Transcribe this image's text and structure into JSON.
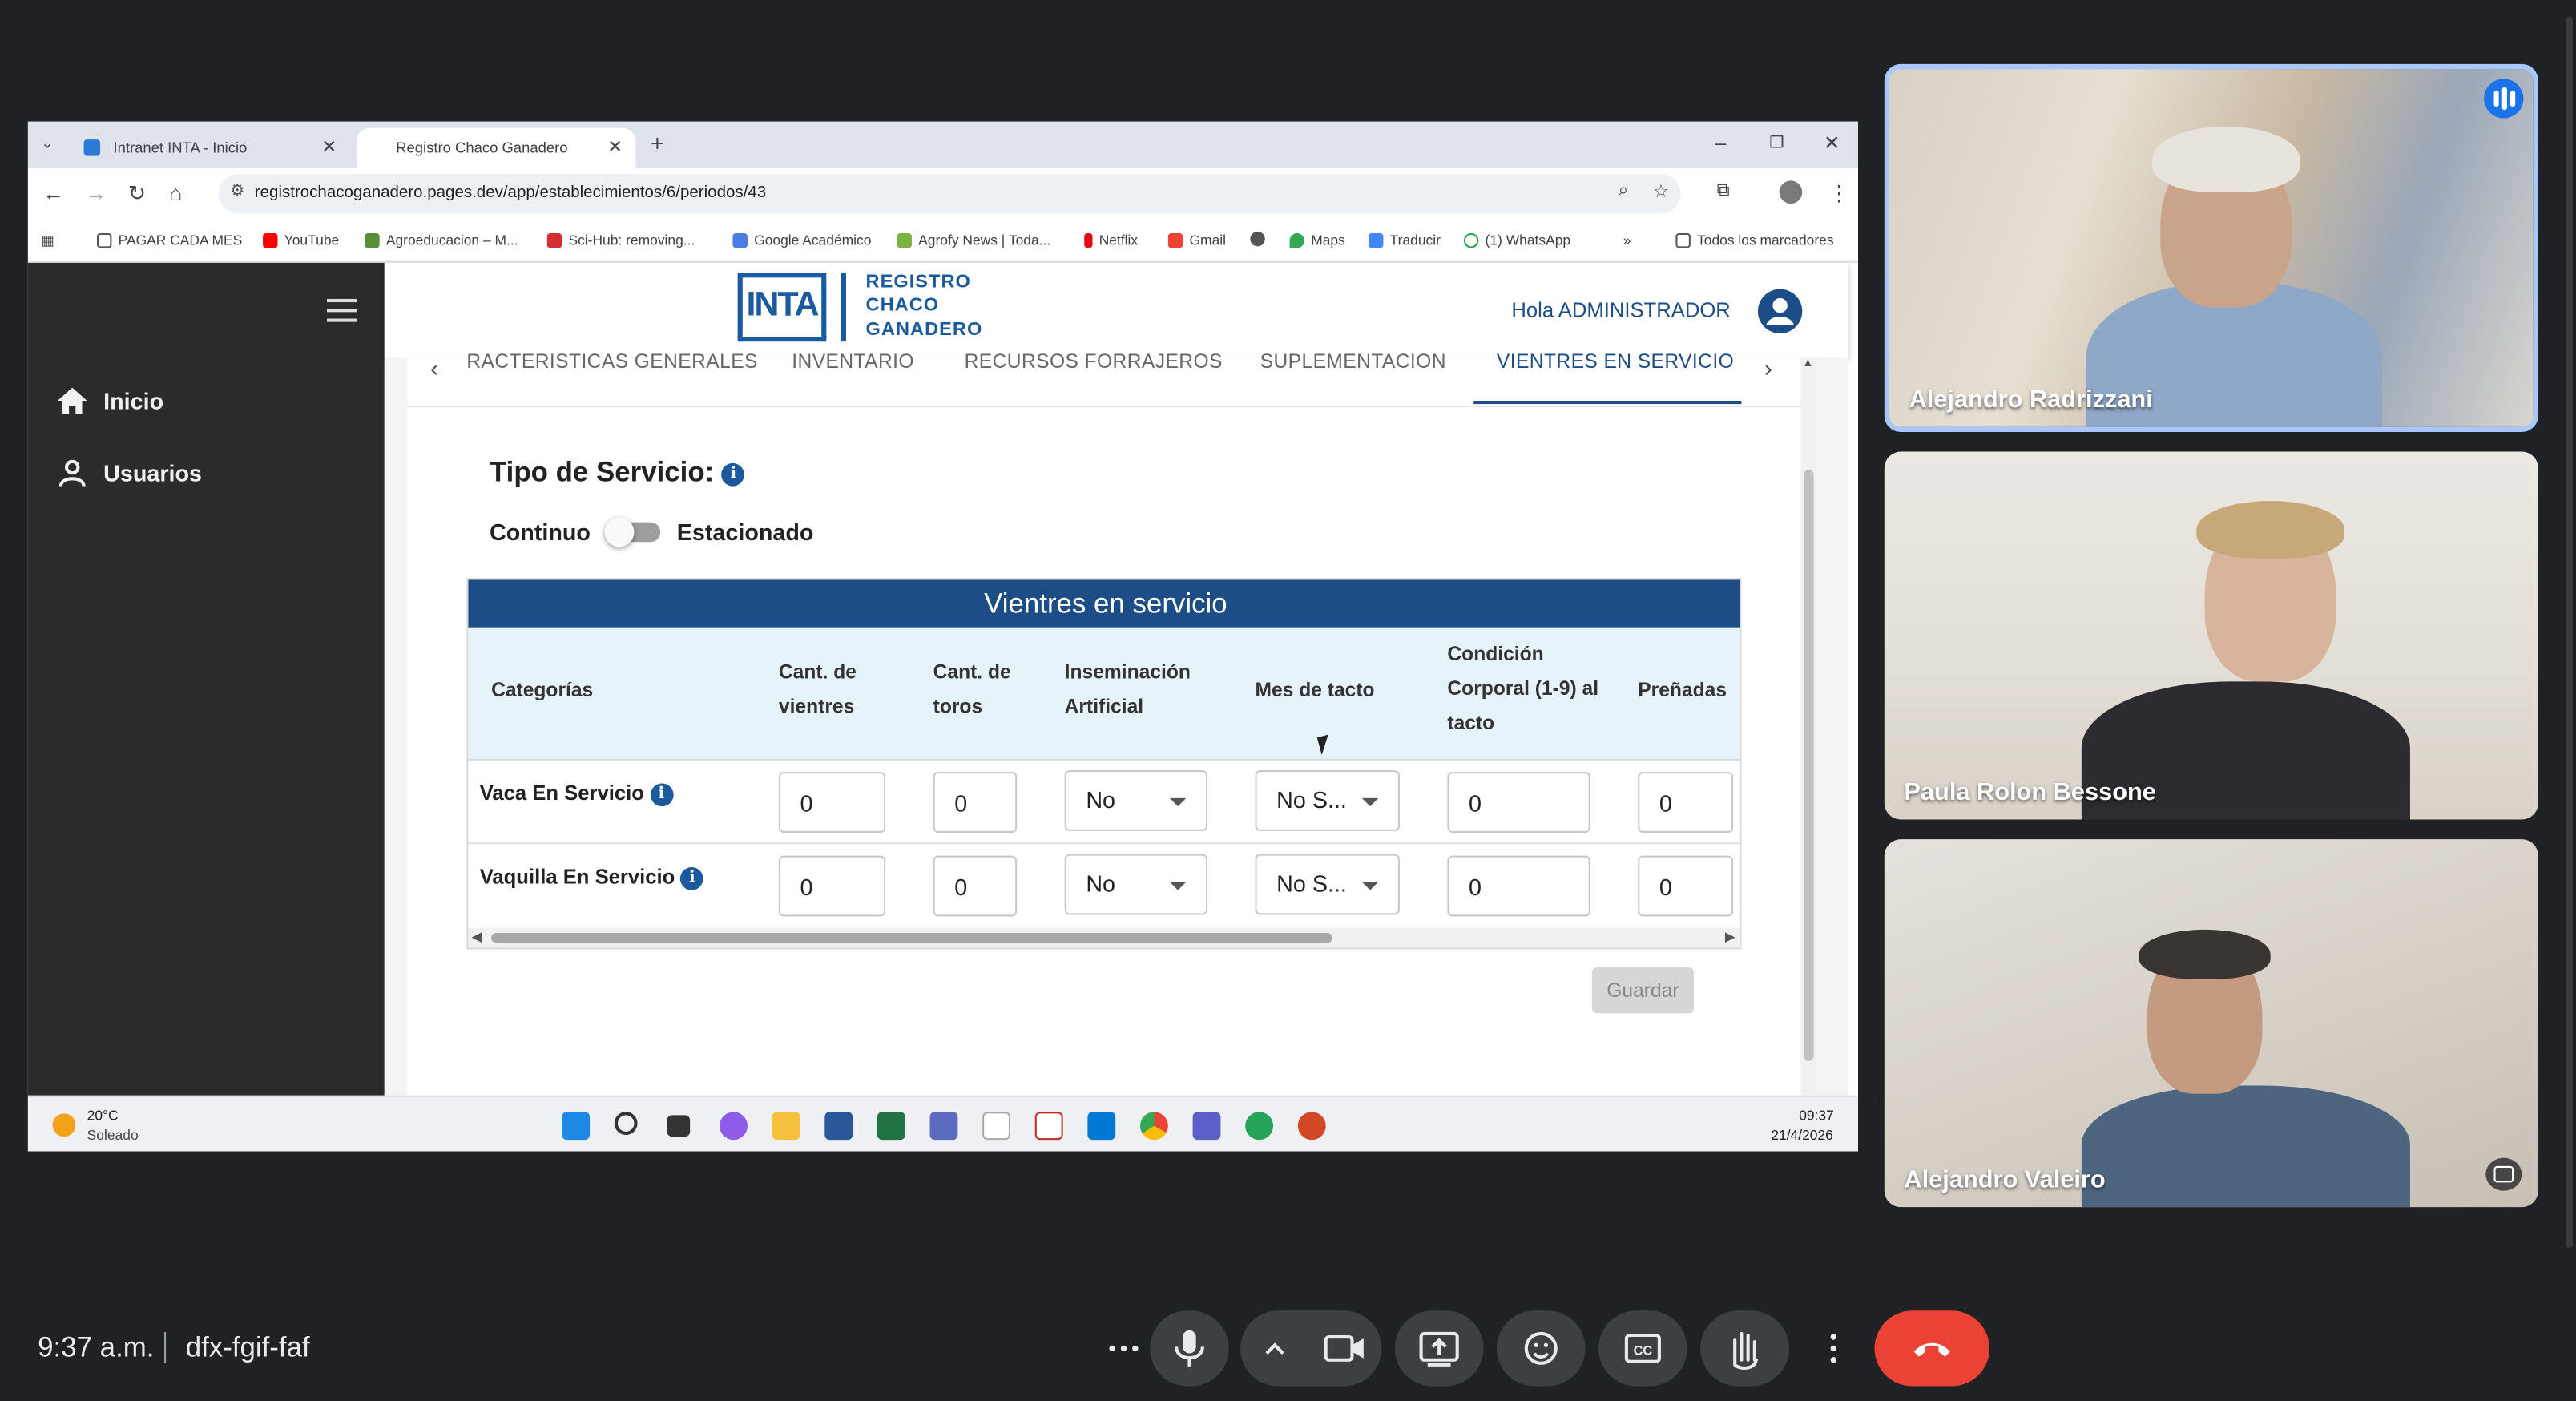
{
  "meet": {
    "time": "9:37 a.m.",
    "meeting_code": "dfx-fgif-faf"
  },
  "participants": [
    {
      "name": "Alejandro Radrizzani",
      "speaking": true
    },
    {
      "name": "Paula Rolon Bessone",
      "speaking": false
    },
    {
      "name": "Alejandro Valeiro",
      "speaking": false
    }
  ],
  "browser": {
    "tabs": [
      {
        "label": "Intranet INTA - Inicio"
      },
      {
        "label": "Registro Chaco Ganadero"
      }
    ],
    "url": "registrochacoganadero.pages.dev/app/establecimientos/6/periodos/43",
    "bookmarks": [
      "PAGAR CADA MES",
      "YouTube",
      "Agroeducacion – M...",
      "Sci-Hub: removing...",
      "Google Académico",
      "Agrofy News | Toda...",
      "Netflix",
      "Gmail",
      "Maps",
      "Traducir",
      "(1) WhatsApp"
    ],
    "all_bookmarks": "Todos los marcadores"
  },
  "app": {
    "sidebar": [
      {
        "label": "Inicio"
      },
      {
        "label": "Usuarios"
      }
    ],
    "logo": {
      "mark": "INTA",
      "line1": "REGISTRO",
      "line2": "CHACO",
      "line3": "GANADERO"
    },
    "greeting": "Hola ADMINISTRADOR",
    "tabs": [
      {
        "label": "RACTERISTICAS GENERALES"
      },
      {
        "label": "INVENTARIO"
      },
      {
        "label": "RECURSOS FORRAJEROS"
      },
      {
        "label": "SUPLEMENTACION"
      },
      {
        "label": "VIENTRES EN SERVICIO",
        "active": true
      }
    ],
    "service_type": {
      "title": "Tipo de Servicio:",
      "option_left": "Continuo",
      "option_right": "Estacionado"
    },
    "table": {
      "title": "Vientres en servicio",
      "columns": [
        "Categorías",
        "Cant. de vientres",
        "Cant. de toros",
        "Inseminación Artificial",
        "Mes de tacto",
        "Condición Corporal (1-9) al tacto",
        "Preñadas"
      ],
      "rows": [
        {
          "category": "Vaca En Servicio",
          "vientres": "0",
          "toros": "0",
          "inseminacion": "No",
          "mes_tacto": "No S...",
          "condicion": "0",
          "prenadas": "0"
        },
        {
          "category": "Vaquilla En Servicio",
          "vientres": "0",
          "toros": "0",
          "inseminacion": "No",
          "mes_tacto": "No S...",
          "condicion": "0",
          "prenadas": "0"
        }
      ]
    },
    "save_label": "Guardar"
  },
  "taskbar": {
    "temperature": "20°C",
    "weather": "Soleado",
    "time": "09:37",
    "date": "21/4/2026"
  }
}
